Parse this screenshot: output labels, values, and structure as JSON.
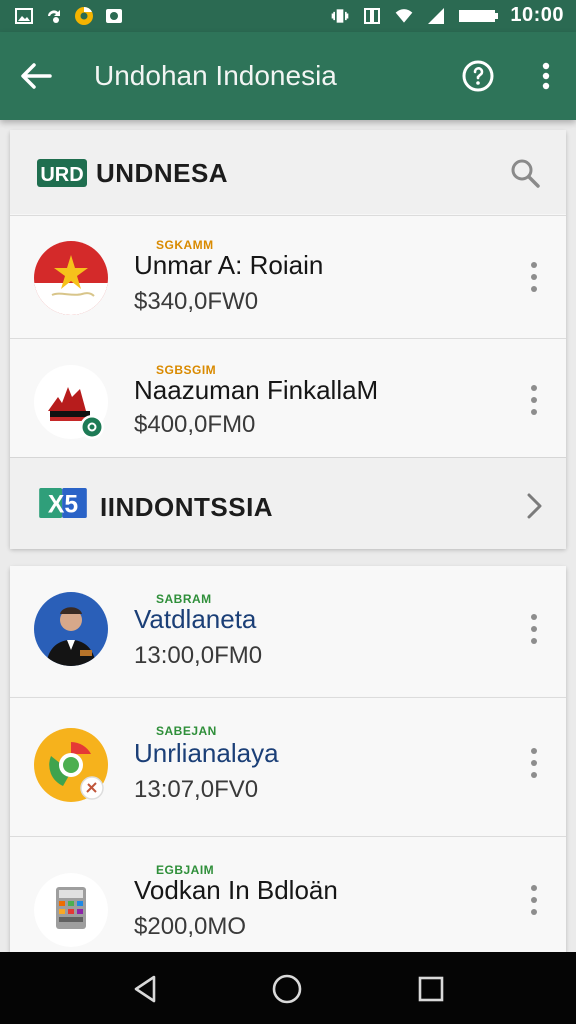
{
  "status_bar": {
    "time": "10:00",
    "icons": [
      "image-icon",
      "sync-icon",
      "chrome-icon",
      "camera-icon",
      "vibrate-icon",
      "nfc-icon",
      "wifi-icon",
      "signal-icon",
      "battery-icon"
    ]
  },
  "app_bar": {
    "title": "Undohan Indonesia",
    "back_icon": "arrow-left-icon",
    "help_icon": "help-circle-icon",
    "more_icon": "more-vert-icon"
  },
  "section1": {
    "logo": "URD",
    "title": "UNDNESA",
    "action_icon": "search-icon",
    "items": [
      {
        "tag": "SGKAMM",
        "name": "Unmar A: Roiain",
        "price": "$340,0FW0"
      },
      {
        "tag": "SGBSGIM",
        "name": "Naazuman FinkallaM",
        "price": "$400,0FM0"
      }
    ]
  },
  "section2": {
    "logo": "X5",
    "title": "IINDONTSSIA",
    "action_icon": "chevron-right-icon"
  },
  "section3": {
    "items": [
      {
        "tag": "SABRAM",
        "name": "Vatdlaneta",
        "price": "13:00,0FM0"
      },
      {
        "tag": "SABEJAN",
        "name": "Unrlianalaya",
        "price": "13:07,0FV0"
      },
      {
        "tag": "EGBJAIM",
        "name": "Vodkan In Bdloän",
        "price": "$200,0MO"
      }
    ]
  },
  "nav_bar": {
    "icons": [
      "back-triangle-icon",
      "home-circle-icon",
      "recents-square-icon"
    ]
  },
  "colors": {
    "primary": "#2e7459",
    "status": "#2b6a52",
    "card": "#f7f7f7",
    "tag_green": "#2f8f3a",
    "tag_orange": "#d98a00"
  }
}
